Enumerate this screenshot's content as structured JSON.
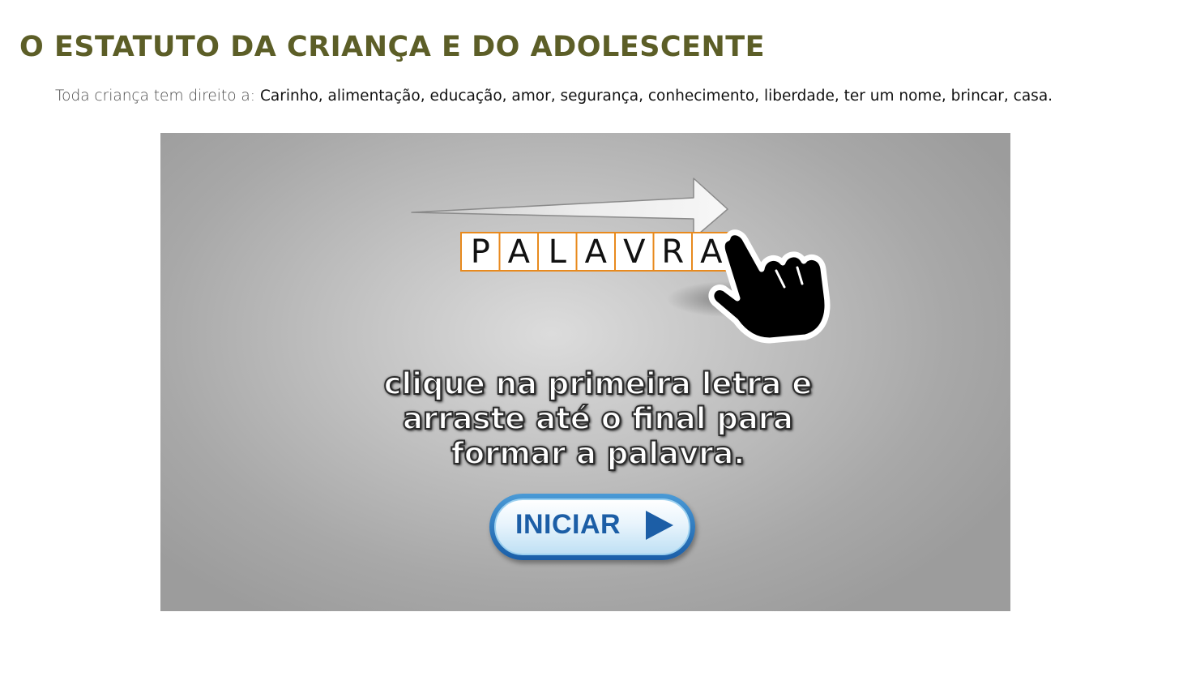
{
  "page": {
    "title": "O ESTATUTO DA CRIANÇA E DO ADOLESCENTE",
    "intro_lead": "Toda criança tem direito a:",
    "intro_rights": "Carinho, alimentação, educação, amor, segurança, conhecimento, liberdade, ter um nome, brincar, casa."
  },
  "game": {
    "demo_word_letters": [
      "P",
      "A",
      "L",
      "A",
      "V",
      "R",
      "A"
    ],
    "instruction_lines": [
      "clique na primeira letra e",
      "arraste até o final para",
      "formar a palavra."
    ],
    "start_button_label": "INICIAR",
    "colors": {
      "tile_border": "#e88a1e",
      "button_text": "#1c5ea6",
      "title": "#5c5e27"
    }
  }
}
